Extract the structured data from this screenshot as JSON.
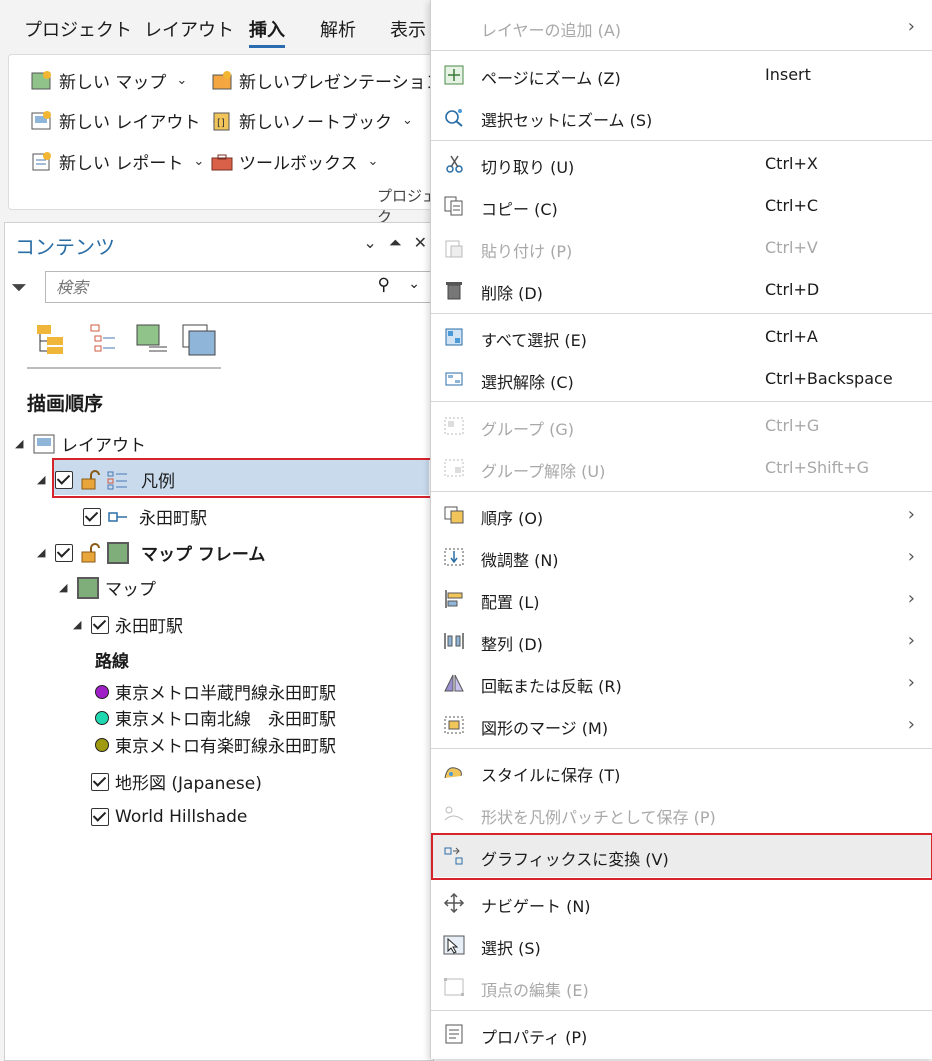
{
  "ribbon": {
    "tabs": [
      "プロジェクト",
      "レイアウト",
      "挿入",
      "解析",
      "表示"
    ],
    "buttons": {
      "new_map": "新しい マップ",
      "new_presentation": "新しいプレゼンテーション",
      "new_layout": "新しい レイアウト",
      "new_notebook": "新しいノートブック",
      "new_report": "新しい レポート",
      "toolbox": "ツールボックス"
    },
    "group_label": "プロジェク"
  },
  "contents": {
    "title": "コンテンツ",
    "search_placeholder": "検索",
    "section_title": "描画順序",
    "tree": {
      "layout": "レイアウト",
      "legend": "凡例",
      "legend_child": "永田町駅",
      "map_frame": "マップ フレーム",
      "map": "マップ",
      "layer": "永田町駅",
      "group_heading": "路線",
      "routes": [
        {
          "label": "東京メトロ半蔵門線永田町駅",
          "color": "#a020c8"
        },
        {
          "label": "東京メトロ南北線　永田町駅",
          "color": "#20d8b0"
        },
        {
          "label": "東京メトロ有楽町線永田町駅",
          "color": "#a09a10"
        }
      ],
      "basemap1": "地形図 (Japanese)",
      "basemap2": "World Hillshade"
    }
  },
  "menu": {
    "items": [
      {
        "label": "レイヤーの追加 (A)",
        "shortcut": "",
        "disabled": true,
        "submenu": true,
        "icon": "none"
      },
      {
        "label": "ページにズーム (Z)",
        "shortcut": "Insert",
        "disabled": false,
        "submenu": false,
        "icon": "zoom-page-icon"
      },
      {
        "label": "選択セットにズーム (S)",
        "shortcut": "",
        "disabled": false,
        "submenu": false,
        "icon": "zoom-selection-icon"
      },
      {
        "label": "切り取り (U)",
        "shortcut": "Ctrl+X",
        "disabled": false,
        "submenu": false,
        "icon": "scissors-icon"
      },
      {
        "label": "コピー (C)",
        "shortcut": "Ctrl+C",
        "disabled": false,
        "submenu": false,
        "icon": "copy-icon"
      },
      {
        "label": "貼り付け (P)",
        "shortcut": "Ctrl+V",
        "disabled": true,
        "submenu": false,
        "icon": "paste-icon"
      },
      {
        "label": "削除 (D)",
        "shortcut": "Ctrl+D",
        "disabled": false,
        "submenu": false,
        "icon": "trash-icon"
      },
      {
        "label": "すべて選択 (E)",
        "shortcut": "Ctrl+A",
        "disabled": false,
        "submenu": false,
        "icon": "select-all-icon"
      },
      {
        "label": "選択解除 (C)",
        "shortcut": "Ctrl+Backspace",
        "disabled": false,
        "submenu": false,
        "icon": "clear-selection-icon"
      },
      {
        "label": "グループ (G)",
        "shortcut": "Ctrl+G",
        "disabled": true,
        "submenu": false,
        "icon": "group-icon"
      },
      {
        "label": "グループ解除 (U)",
        "shortcut": "Ctrl+Shift+G",
        "disabled": true,
        "submenu": false,
        "icon": "ungroup-icon"
      },
      {
        "label": "順序 (O)",
        "shortcut": "",
        "disabled": false,
        "submenu": true,
        "icon": "order-icon"
      },
      {
        "label": "微調整 (N)",
        "shortcut": "",
        "disabled": false,
        "submenu": true,
        "icon": "nudge-icon"
      },
      {
        "label": "配置 (L)",
        "shortcut": "",
        "disabled": false,
        "submenu": true,
        "icon": "align-icon"
      },
      {
        "label": "整列 (D)",
        "shortcut": "",
        "disabled": false,
        "submenu": true,
        "icon": "distribute-icon"
      },
      {
        "label": "回転または反転 (R)",
        "shortcut": "",
        "disabled": false,
        "submenu": true,
        "icon": "rotate-flip-icon"
      },
      {
        "label": "図形のマージ (M)",
        "shortcut": "",
        "disabled": false,
        "submenu": true,
        "icon": "merge-shapes-icon"
      },
      {
        "label": "スタイルに保存 (T)",
        "shortcut": "",
        "disabled": false,
        "submenu": false,
        "icon": "save-style-icon"
      },
      {
        "label": "形状を凡例パッチとして保存 (P)",
        "shortcut": "",
        "disabled": true,
        "submenu": false,
        "icon": "legend-patch-icon"
      },
      {
        "label": "グラフィックスに変換 (V)",
        "shortcut": "",
        "disabled": false,
        "submenu": false,
        "icon": "convert-graphics-icon"
      },
      {
        "label": "ナビゲート (N)",
        "shortcut": "",
        "disabled": false,
        "submenu": false,
        "icon": "navigate-icon"
      },
      {
        "label": "選択 (S)",
        "shortcut": "",
        "disabled": false,
        "submenu": false,
        "icon": "select-icon"
      },
      {
        "label": "頂点の編集 (E)",
        "shortcut": "",
        "disabled": true,
        "submenu": false,
        "icon": "edit-vertices-icon"
      },
      {
        "label": "プロパティ (P)",
        "shortcut": "",
        "disabled": false,
        "submenu": false,
        "icon": "properties-icon"
      }
    ],
    "accent": "#d6242c"
  }
}
